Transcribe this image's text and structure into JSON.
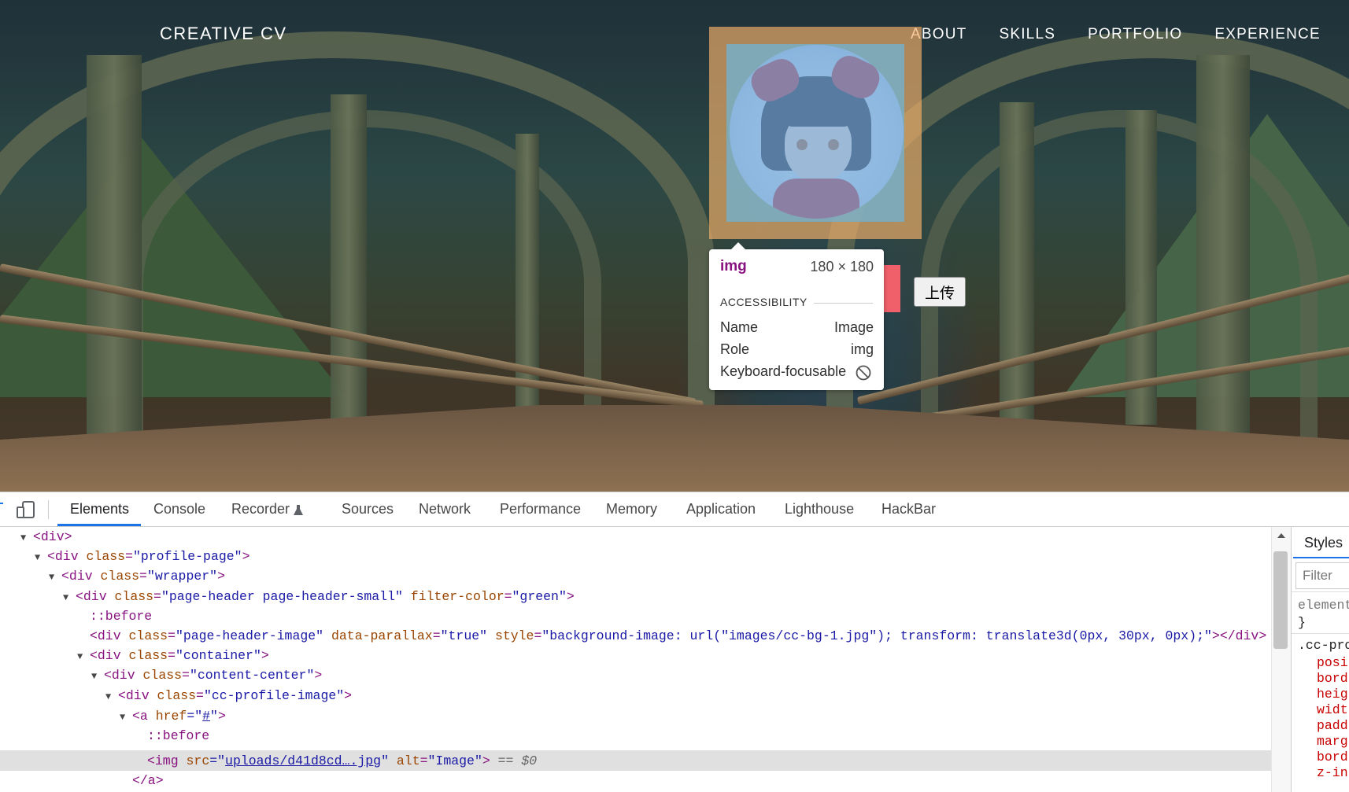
{
  "page": {
    "brand": "CREATIVE CV",
    "nav": [
      "ABOUT",
      "SKILLS",
      "PORTFOLIO",
      "EXPERIENCE"
    ],
    "upload_label": "上传"
  },
  "tooltip": {
    "tag": "img",
    "size": "180 × 180",
    "section": "ACCESSIBILITY",
    "rows": [
      {
        "label": "Name",
        "value": "Image"
      },
      {
        "label": "Role",
        "value": "img"
      },
      {
        "label": "Keyboard-focusable",
        "value": ""
      }
    ]
  },
  "devtools": {
    "tabs": [
      "Elements",
      "Console",
      "Recorder",
      "Sources",
      "Network",
      "Performance",
      "Memory",
      "Application",
      "Lighthouse",
      "HackBar"
    ],
    "active_tab": "Elements",
    "dom": {
      "l0": "<div>",
      "l1_tag": "<div",
      "l1_attr": "class",
      "l1_val": "\"profile-page\"",
      "l2_tag": "<div",
      "l2_attr": "class",
      "l2_val": "\"wrapper\"",
      "l3_tag": "<div",
      "l3_attr1": "class",
      "l3_val1": "\"page-header page-header-small\"",
      "l3_attr2": "filter-color",
      "l3_val2": "\"green\"",
      "l4": "::before",
      "l5_tag": "<div",
      "l5_attr1": "class",
      "l5_val1": "\"page-header-image\"",
      "l5_attr2": "data-parallax",
      "l5_val2": "\"true\"",
      "l5_attr3": "style",
      "l5_val3": "\"background-image: url(\"images/cc-bg-1.jpg\"); transform: translate3d(0px, 30px, 0px);\"",
      "l5_close": "></div>",
      "l6_tag": "<div",
      "l6_attr": "class",
      "l6_val": "\"container\"",
      "l7_tag": "<div",
      "l7_attr": "class",
      "l7_val": "\"content-center\"",
      "l8_tag": "<div",
      "l8_attr": "class",
      "l8_val": "\"cc-profile-image\"",
      "l9_tag": "<a",
      "l9_attr": "href",
      "l9_q1": "=\"",
      "l9_link": "#",
      "l9_q2": "\"",
      "l10": "::before",
      "l11_tag": "<img",
      "l11_attr1": "src",
      "l11_link": "uploads/d41d8cd….jpg",
      "l11_attr2": "alt",
      "l11_val2": "\"Image\"",
      "l11_tail": " == $0",
      "l12": "</a>"
    },
    "styles": {
      "tab": "Styles",
      "filter_placeholder": "Filter",
      "element_style": "element",
      "brace": "}",
      "selector": ".cc-pro",
      "props": [
        "posi",
        "bord",
        "heig",
        "widt",
        "padd",
        "marg",
        "bord",
        "z-in"
      ]
    }
  },
  "colors": {
    "tag": "#881280",
    "attr_name": "#994500",
    "attr_value": "#1a1aa6",
    "accent": "#1a73e8"
  }
}
